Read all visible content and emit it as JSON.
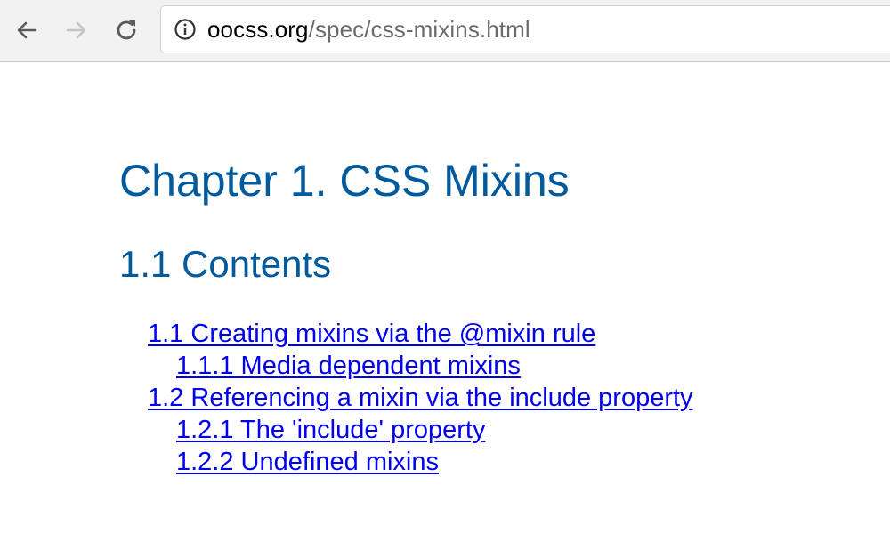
{
  "browser": {
    "back_icon": "back-arrow-icon",
    "forward_icon": "forward-arrow-icon",
    "reload_icon": "reload-icon",
    "info_icon": "info-icon",
    "url_host": "oocss.org",
    "url_path": "/spec/css-mixins.html",
    "forward_enabled": false
  },
  "page": {
    "chapter_title": "Chapter 1. CSS Mixins",
    "section_title": "1.1 Contents",
    "toc": [
      {
        "label": "1.1 Creating mixins via the @mixin rule",
        "level": 1
      },
      {
        "label": "1.1.1 Media dependent mixins",
        "level": 2
      },
      {
        "label": "1.2 Referencing a mixin via the include property",
        "level": 1
      },
      {
        "label": "1.2.1 The 'include' property",
        "level": 2
      },
      {
        "label": "1.2.2 Undefined mixins",
        "level": 2
      }
    ]
  },
  "colors": {
    "heading": "#005a9c",
    "link": "#0000ee",
    "toolbar_bg": "#f2f2f2"
  }
}
